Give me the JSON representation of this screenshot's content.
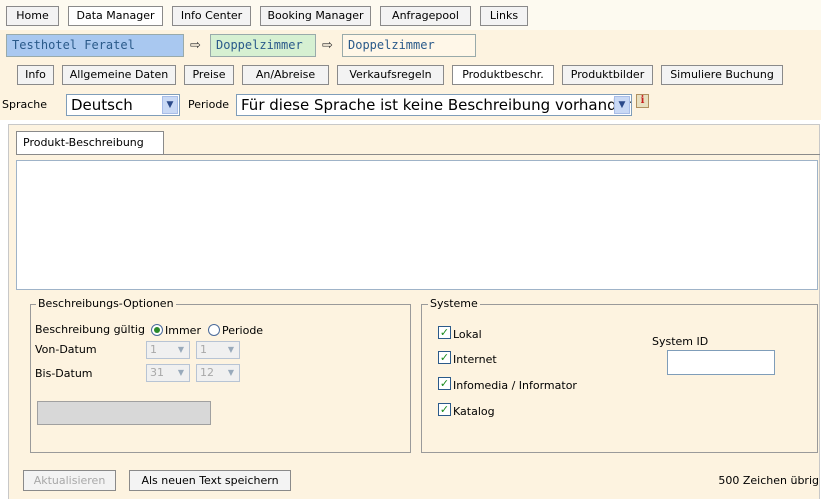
{
  "top_tabs": [
    {
      "label": "Home"
    },
    {
      "label": "Data Manager"
    },
    {
      "label": "Info Center"
    },
    {
      "label": "Booking Manager"
    },
    {
      "label": "Anfragepool"
    },
    {
      "label": "Links"
    }
  ],
  "breadcrumb": {
    "items": [
      {
        "label": "Testhotel Feratel",
        "color": "#a9c8f0"
      },
      {
        "label": "Doppelzimmer",
        "color": "#d6f0d2"
      },
      {
        "label": "Doppelzimmer",
        "color": "#fff7e8"
      }
    ],
    "separator": "⇨"
  },
  "product_tabs": [
    {
      "label": "Info"
    },
    {
      "label": "Allgemeine Daten"
    },
    {
      "label": "Preise"
    },
    {
      "label": "An/Abreise"
    },
    {
      "label": "Verkaufsregeln"
    },
    {
      "label": "Produktbeschr."
    },
    {
      "label": "Produktbilder"
    },
    {
      "label": "Simuliere Buchung"
    }
  ],
  "filter": {
    "language_label": "Sprache",
    "language_value": "Deutsch",
    "period_label": "Periode",
    "period_value": "Für diese Sprache ist keine Beschreibung vorhanden",
    "info_icon": "i"
  },
  "description_tab": "Produkt-Beschreibung",
  "description_text": "",
  "options": {
    "legend": "Beschreibungs-Optionen",
    "valid_label": "Beschreibung gültig",
    "radio_always": "Immer",
    "radio_period": "Periode",
    "from_label": "Von-Datum",
    "to_label": "Bis-Datum",
    "from_day": "1",
    "from_month": "1",
    "to_day": "31",
    "to_month": "12",
    "period_field": ""
  },
  "systems": {
    "legend": "Systeme",
    "items": [
      {
        "label": "Lokal",
        "checked": true
      },
      {
        "label": "Internet",
        "checked": true
      },
      {
        "label": "Infomedia / Informator",
        "checked": true
      },
      {
        "label": "Katalog",
        "checked": true
      }
    ],
    "system_id_label": "System ID",
    "system_id_value": ""
  },
  "actions": {
    "update_label": "Aktualisieren",
    "save_new_label": "Als neuen Text speichern",
    "chars_left": "500 Zeichen übrig"
  }
}
